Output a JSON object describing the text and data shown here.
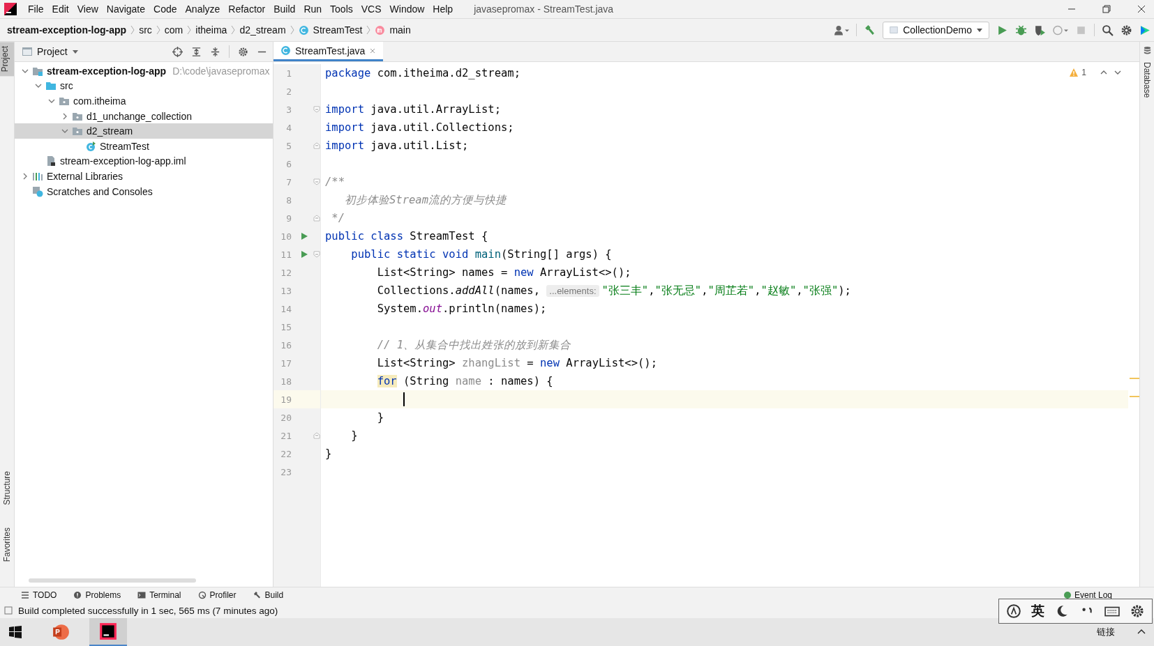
{
  "menu": [
    "File",
    "Edit",
    "View",
    "Navigate",
    "Code",
    "Analyze",
    "Refactor",
    "Build",
    "Run",
    "Tools",
    "VCS",
    "Window",
    "Help"
  ],
  "window": {
    "title": "javasepromax - StreamTest.java"
  },
  "breadcrumb": [
    {
      "label": "stream-exception-log-app",
      "kind": "module"
    },
    {
      "label": "src",
      "kind": "plain"
    },
    {
      "label": "com",
      "kind": "plain"
    },
    {
      "label": "itheima",
      "kind": "plain"
    },
    {
      "label": "d2_stream",
      "kind": "plain"
    },
    {
      "label": "StreamTest",
      "kind": "class"
    },
    {
      "label": "main",
      "kind": "method"
    }
  ],
  "run_config": "CollectionDemo",
  "project_panel": {
    "title": "Project"
  },
  "tree": [
    {
      "label": "stream-exception-log-app",
      "kind": "module",
      "path": "D:\\code\\javasepromax",
      "expanded": true,
      "selected": false,
      "children": [
        {
          "label": "src",
          "kind": "src",
          "expanded": true,
          "selected": false,
          "children": [
            {
              "label": "com.itheima",
              "kind": "package",
              "expanded": true,
              "selected": false,
              "children": [
                {
                  "label": "d1_unchange_collection",
                  "kind": "package",
                  "expanded": false,
                  "selected": false
                },
                {
                  "label": "d2_stream",
                  "kind": "package",
                  "expanded": true,
                  "selected": true,
                  "children": [
                    {
                      "label": "StreamTest",
                      "kind": "class",
                      "selected": false
                    }
                  ]
                }
              ]
            }
          ]
        },
        {
          "label": "stream-exception-log-app.iml",
          "kind": "iml",
          "selected": false
        }
      ]
    },
    {
      "label": "External Libraries",
      "kind": "library",
      "expanded": false,
      "selected": false
    },
    {
      "label": "Scratches and Consoles",
      "kind": "scratch",
      "selected": false
    }
  ],
  "tabs": [
    {
      "label": "StreamTest.java",
      "selected": true
    }
  ],
  "warnings": "1",
  "code": [
    {
      "number": "1",
      "tokens": [
        {
          "t": "package",
          "kind": "kw"
        },
        {
          "t": " com.itheima.d2_stream;",
          "kind": "plain"
        }
      ]
    },
    {
      "number": "2"
    },
    {
      "number": "3",
      "fold_start": true,
      "tokens": [
        {
          "t": "import",
          "kind": "kw"
        },
        {
          "t": " java.util.ArrayList;",
          "kind": "plain"
        }
      ]
    },
    {
      "number": "4",
      "tokens": [
        {
          "t": "import",
          "kind": "kw"
        },
        {
          "t": " java.util.Collections;",
          "kind": "plain"
        }
      ]
    },
    {
      "number": "5",
      "fold_end": true,
      "tokens": [
        {
          "t": "import",
          "kind": "kw"
        },
        {
          "t": " java.util.List;",
          "kind": "plain"
        }
      ]
    },
    {
      "number": "6"
    },
    {
      "number": "7",
      "fold_start": true,
      "tokens": [
        {
          "t": "/**",
          "kind": "comment"
        }
      ]
    },
    {
      "number": "8",
      "tokens": [
        {
          "t": "   初步体验Stream流的方便与快捷",
          "kind": "comment"
        }
      ]
    },
    {
      "number": "9",
      "fold_end": true,
      "tokens": [
        {
          "t": " */",
          "kind": "comment"
        }
      ]
    },
    {
      "number": "10",
      "run": true,
      "tokens": [
        {
          "t": "public class",
          "kind": "kw"
        },
        {
          "t": " StreamTest {",
          "kind": "plain"
        }
      ]
    },
    {
      "number": "11",
      "run": true,
      "fold_start": true,
      "tokens": [
        {
          "t": "    public static void",
          "kind": "kw"
        },
        {
          "t": " main",
          "kind": "fn"
        },
        {
          "t": "(String[] args) {",
          "kind": "plain"
        }
      ]
    },
    {
      "number": "12",
      "tokens": [
        {
          "t": "        List<String> names = ",
          "kind": "plain"
        },
        {
          "t": "new",
          "kind": "kw"
        },
        {
          "t": " ArrayList<>();",
          "kind": "plain"
        }
      ]
    },
    {
      "number": "13",
      "tokens": [
        {
          "t": "        Collections.",
          "kind": "plain"
        },
        {
          "t": "addAll",
          "kind": "italic"
        },
        {
          "t": "(names, ",
          "kind": "plain"
        },
        {
          "t": "...elements:",
          "kind": "hint"
        },
        {
          "t": "\"张三丰\"",
          "kind": "str"
        },
        {
          "t": ",",
          "kind": "plain"
        },
        {
          "t": "\"张无忌\"",
          "kind": "str"
        },
        {
          "t": ",",
          "kind": "plain"
        },
        {
          "t": "\"周芷若\"",
          "kind": "str"
        },
        {
          "t": ",",
          "kind": "plain"
        },
        {
          "t": "\"赵敏\"",
          "kind": "str"
        },
        {
          "t": ",",
          "kind": "plain"
        },
        {
          "t": "\"张强\"",
          "kind": "str"
        },
        {
          "t": ");",
          "kind": "plain"
        }
      ]
    },
    {
      "number": "14",
      "tokens": [
        {
          "t": "        System.",
          "kind": "plain"
        },
        {
          "t": "out",
          "kind": "static"
        },
        {
          "t": ".println(names);",
          "kind": "plain"
        }
      ]
    },
    {
      "number": "15"
    },
    {
      "number": "16",
      "tokens": [
        {
          "t": "        // 1、从集合中找出姓张的放到新集合",
          "kind": "comment"
        }
      ]
    },
    {
      "number": "17",
      "tokens": [
        {
          "t": "        List<String>",
          "kind": "plain"
        },
        {
          "t": " zhangList",
          "kind": "unused"
        },
        {
          "t": " = ",
          "kind": "plain"
        },
        {
          "t": "new",
          "kind": "kw"
        },
        {
          "t": " ArrayList<>();",
          "kind": "plain"
        }
      ]
    },
    {
      "number": "18",
      "tokens": [
        {
          "t": "        for",
          "kind": "match"
        },
        {
          "t": " (String",
          "kind": "plain"
        },
        {
          "t": " name",
          "kind": "unused"
        },
        {
          "t": " : names) {",
          "kind": "plain"
        }
      ]
    },
    {
      "number": "19",
      "current": true,
      "caret": true
    },
    {
      "number": "20",
      "tokens": [
        {
          "t": "        }",
          "kind": "plain"
        }
      ]
    },
    {
      "number": "21",
      "fold_end": true,
      "tokens": [
        {
          "t": "    }",
          "kind": "plain"
        }
      ]
    },
    {
      "number": "22",
      "tokens": [
        {
          "t": "}",
          "kind": "plain"
        }
      ]
    },
    {
      "number": "23"
    }
  ],
  "left_strip": [
    {
      "label": "Project",
      "selected": true
    },
    {
      "label": "Structure",
      "selected": false
    },
    {
      "label": "Favorites",
      "selected": false
    }
  ],
  "right_strip": [
    {
      "label": "Database"
    }
  ],
  "tool_windows": [
    {
      "label": "TODO",
      "kind": "list"
    },
    {
      "label": "Problems",
      "kind": "problems"
    },
    {
      "label": "Terminal",
      "kind": "terminal"
    },
    {
      "label": "Profiler",
      "kind": "profiler"
    },
    {
      "label": "Build",
      "kind": "build"
    }
  ],
  "event_log": "Event Log",
  "status_bar": "Build completed successfully in 1 sec, 565 ms (7 minutes ago)",
  "ime_bar": {
    "mode": "英"
  },
  "taskbar": {
    "apps": [
      {
        "kind": "powerpoint",
        "selected": false
      },
      {
        "kind": "intellij",
        "selected": true
      }
    ],
    "tray_text": "链接"
  }
}
